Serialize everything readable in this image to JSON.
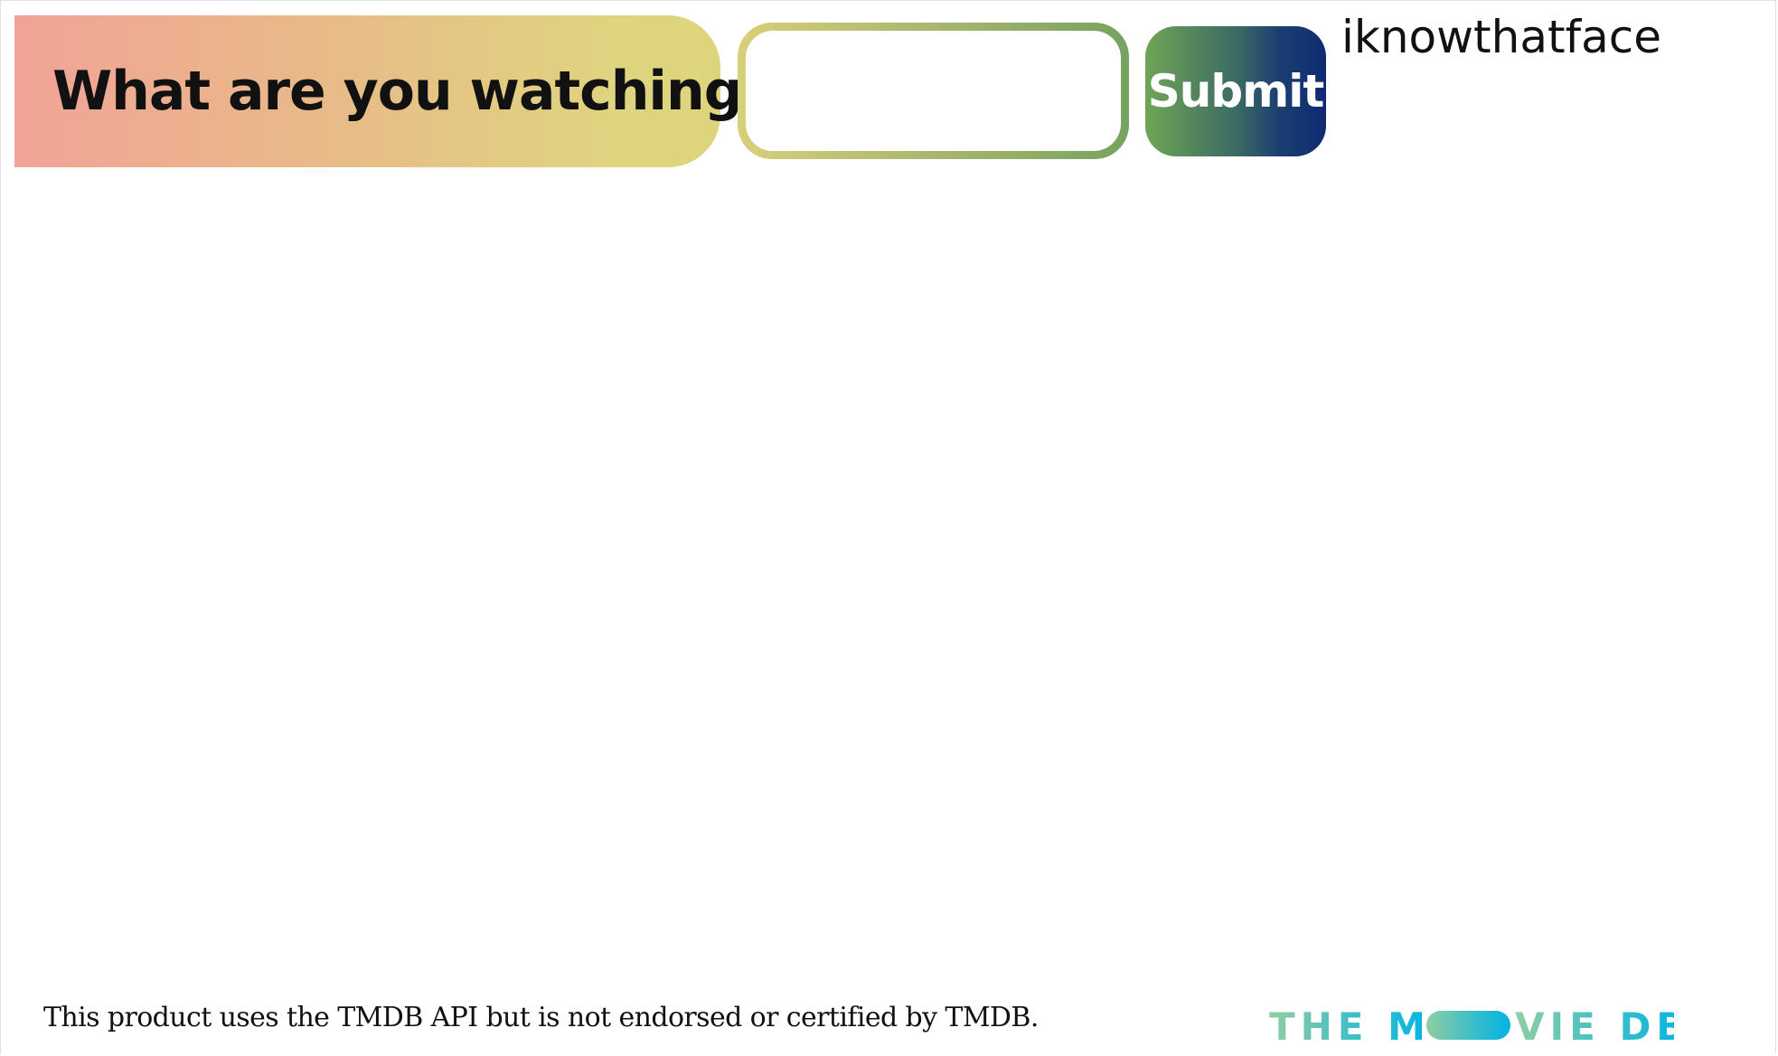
{
  "header": {
    "prompt": "What are you watching?",
    "search": {
      "value": "",
      "placeholder": ""
    },
    "submit_label": "Submit",
    "brand": "iknowthatface"
  },
  "footer": {
    "attribution": "This product uses the TMDB API but is not endorsed or certified by TMDB.",
    "logo_text_left": "THE M",
    "logo_text_right": "VIE DB",
    "logo_name": "tmdb-logo"
  },
  "colors": {
    "prompt_gradient": [
      "#f1a396",
      "#ddd57e"
    ],
    "search_border_gradient": [
      "#d8d07a",
      "#76a25f"
    ],
    "submit_gradient": [
      "#6fa456",
      "#0f2a72"
    ],
    "tmdb_logo_gradient": [
      "#90cea1",
      "#01b4e4"
    ]
  }
}
